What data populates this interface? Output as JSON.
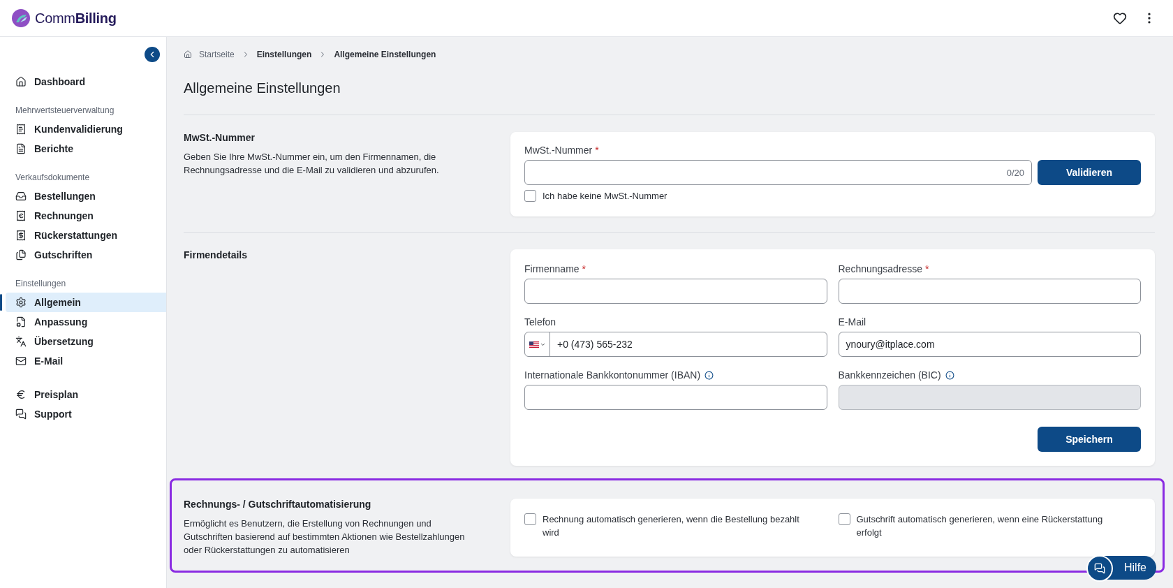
{
  "header": {
    "brand_light": "Comm",
    "brand_bold": "Billing"
  },
  "sidebar": {
    "groups": [
      {
        "items": [
          {
            "label": "Dashboard",
            "selected": false
          }
        ]
      },
      {
        "heading": "Mehrwertsteuerverwaltung",
        "items": [
          {
            "label": "Kundenvalidierung",
            "selected": false
          },
          {
            "label": "Berichte",
            "selected": false
          }
        ]
      },
      {
        "heading": "Verkaufsdokumente",
        "items": [
          {
            "label": "Bestellungen",
            "selected": false
          },
          {
            "label": "Rechnungen",
            "selected": false
          },
          {
            "label": "Rückerstattungen",
            "selected": false
          },
          {
            "label": "Gutschriften",
            "selected": false
          }
        ]
      },
      {
        "heading": "Einstellungen",
        "items": [
          {
            "label": "Allgemein",
            "selected": true
          },
          {
            "label": "Anpassung",
            "selected": false
          },
          {
            "label": "Übersetzung",
            "selected": false
          },
          {
            "label": "E-Mail",
            "selected": false
          }
        ]
      },
      {
        "items": [
          {
            "label": "Preisplan",
            "selected": false
          },
          {
            "label": "Support",
            "selected": false
          }
        ]
      }
    ]
  },
  "breadcrumb": [
    {
      "label": "Startseite"
    },
    {
      "label": "Einstellungen"
    },
    {
      "label": "Allgemeine Einstellungen"
    }
  ],
  "title": "Allgemeine Einstellungen",
  "vat": {
    "title": "MwSt.-Nummer",
    "description": "Geben Sie Ihre MwSt.-Nummer ein, um den Firmennamen, die Rechnungsadresse und die E-Mail zu validieren und abzurufen.",
    "field": {
      "label": "MwSt.-Nummer",
      "required_mark": "*",
      "counter": "0/20"
    },
    "button": "Validieren",
    "checkbox": {
      "label": "Ich habe keine MwSt.-Nummer",
      "checked": false
    }
  },
  "company": {
    "title": "Firmendetails",
    "fields": [
      {
        "kind": "text",
        "label": "Firmenname",
        "required_mark": "*"
      },
      {
        "kind": "text",
        "label": "Rechnungsadresse",
        "required_mark": "*"
      },
      {
        "kind": "phone",
        "label": "Telefon",
        "value": "+0 (473) 565-232"
      },
      {
        "kind": "text",
        "label": "E-Mail",
        "value": "ynoury@itplace.com"
      },
      {
        "kind": "text",
        "label": "Internationale Bankkontonummer (IBAN)",
        "info": true
      },
      {
        "kind": "text",
        "label": "Bankkennzeichen (BIC)",
        "info": true,
        "disabled": true
      }
    ],
    "button": "Speichern"
  },
  "automation": {
    "title": "Rechnungs- / Gutschriftautomatisierung",
    "highlighted": true,
    "description": "Ermöglicht es Benutzern, die Erstellung von Rechnungen und Gutschriften basierend auf bestimmten Aktionen wie Bestellzahlungen oder Rückerstattungen zu automatisieren",
    "options": [
      {
        "label": "Rechnung automatisch generieren, wenn die Bestellung bezahlt wird",
        "checked": false
      },
      {
        "label": "Gutschrift automatisch generieren, wenn eine Rückerstattung erfolgt",
        "checked": false
      }
    ]
  },
  "help_button": "Hilfe"
}
